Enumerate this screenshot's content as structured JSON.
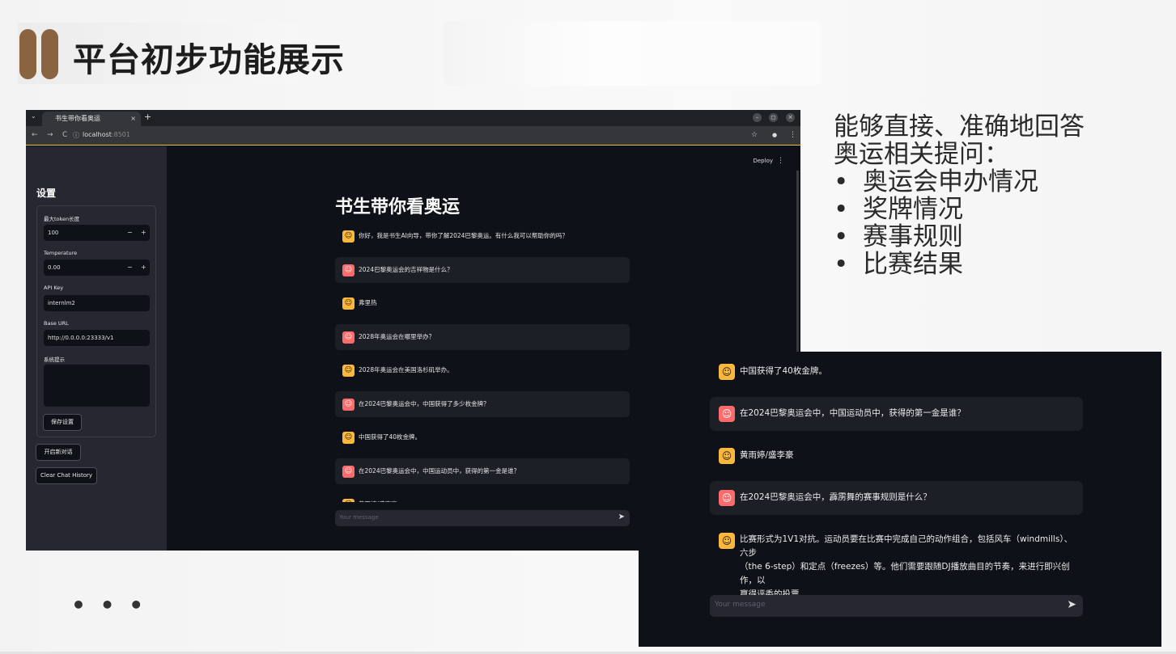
{
  "slide": {
    "title": "平台初步功能展示",
    "ellipsis": "• • •",
    "colors": {
      "accent": "#8a6440",
      "bot_avatar": "#fbb83a",
      "user_avatar": "#ff6a6a",
      "app_bg": "#0e1117"
    }
  },
  "browser": {
    "tab_title": "书生带你看奥运",
    "tab_close": "×",
    "new_tab": "+",
    "url_host": "localhost",
    "url_port": ":8501",
    "nav_back": "←",
    "nav_forward": "→",
    "nav_reload": "C",
    "site_info": "ⓘ",
    "star": "☆",
    "profile": "●",
    "menu": "⋮",
    "win_min": "–",
    "win_max": "◻",
    "win_close": "×",
    "tab_list": "⌄"
  },
  "sidebar": {
    "title": "设置",
    "max_token_label": "最大token长度",
    "max_token_value": "100",
    "temperature_label": "Temperature",
    "temperature_value": "0.00",
    "minus": "−",
    "plus": "+",
    "api_key_label": "API Key",
    "api_key_value": "internlm2",
    "base_url_label": "Base URL",
    "base_url_value": "http://0.0.0.0:23333/v1",
    "system_prompt_label": "系统提示",
    "system_prompt_value": "",
    "save_button": "保存设置",
    "new_chat_button": "开启新对话",
    "clear_button": "Clear Chat History"
  },
  "main": {
    "deploy": "Deploy",
    "kebab": "⋮",
    "title": "书生带你看奥运",
    "messages": [
      {
        "role": "bot",
        "text": "你好，我是书生AI向导，带你了解2024巴黎奥运。有什么我可以帮助你的吗？"
      },
      {
        "role": "user",
        "text": "2024巴黎奥运会的吉祥物是什么？"
      },
      {
        "role": "bot",
        "text": "弗里热"
      },
      {
        "role": "user",
        "text": "2028年奥运会在哪里举办？"
      },
      {
        "role": "bot",
        "text": "2028年奥运会在美国洛杉矶举办。"
      },
      {
        "role": "user",
        "text": "在2024巴黎奥运会中，中国获得了多少枚金牌？"
      },
      {
        "role": "bot",
        "text": "中国获得了40枚金牌。"
      },
      {
        "role": "user",
        "text": "在2024巴黎奥运会中，中国运动员中，获得的第一金是谁？"
      },
      {
        "role": "bot",
        "text": "黄雨婷/盛李豪"
      }
    ],
    "input_placeholder": "Your message",
    "send_icon": "➤",
    "bot_icon": "☺",
    "user_icon": "☺"
  },
  "bullets": {
    "intro": "能够直接、准确地回答奥运相关提问：",
    "intro_line1": "能够直接、准确地回答",
    "intro_line2": "奥运相关提问：",
    "items": [
      "奥运会申办情况",
      "奖牌情况",
      "赛事规则",
      "比赛结果"
    ]
  },
  "zoom": {
    "messages": [
      {
        "role": "bot",
        "text": "中国获得了40枚金牌。"
      },
      {
        "role": "user",
        "text": "在2024巴黎奥运会中，中国运动员中，获得的第一金是谁？"
      },
      {
        "role": "bot",
        "text": "黄雨婷/盛李豪"
      },
      {
        "role": "user",
        "text": "在2024巴黎奥运会中，霹雳舞的赛事规则是什么？"
      },
      {
        "role": "bot",
        "line1": "比赛形式为1V1对抗。运动员要在比赛中完成自己的动作组合，包括风车（windmills）、六步",
        "line2": "（the 6-step）和定点（freezes）等。他们需要跟随DJ播放曲目的节奏，来进行即兴创作，以",
        "line3": "赢得评委的投票。"
      }
    ],
    "input_placeholder": "Your message",
    "send_icon": "➤"
  }
}
